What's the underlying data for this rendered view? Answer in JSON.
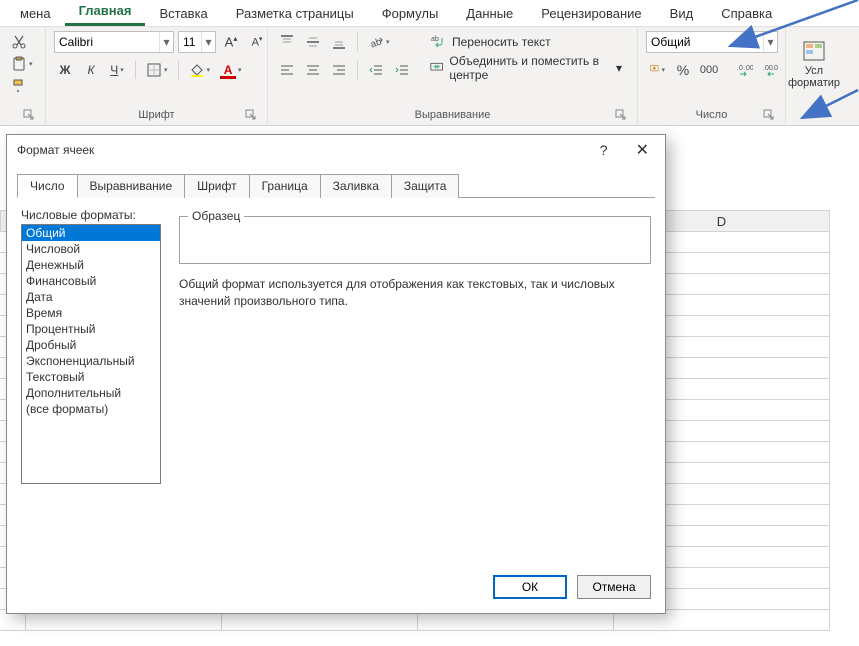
{
  "tabs": {
    "items": [
      "мена",
      "Главная",
      "Вставка",
      "Разметка страницы",
      "Формулы",
      "Данные",
      "Рецензирование",
      "Вид",
      "Справка"
    ],
    "active_index": 1
  },
  "clipboard": {
    "label": ""
  },
  "font": {
    "name": "Calibri",
    "size": "11",
    "group_label": "Шрифт",
    "bold": "Ж",
    "italic": "К",
    "underline": "Ч"
  },
  "alignment": {
    "group_label": "Выравнивание",
    "wrap_label": "Переносить текст",
    "merge_label": "Объединить и поместить в центре"
  },
  "number": {
    "group_label": "Число",
    "format_value": "Общий"
  },
  "cond": {
    "label": "Усл форматир"
  },
  "sheet": {
    "col_D": "D"
  },
  "dialog": {
    "title": "Формат ячеек",
    "help": "?",
    "close": "✕",
    "tabs": [
      "Число",
      "Выравнивание",
      "Шрифт",
      "Граница",
      "Заливка",
      "Защита"
    ],
    "active_tab": 0,
    "list_label": "Числовые форматы:",
    "formats": [
      "Общий",
      "Числовой",
      "Денежный",
      "Финансовый",
      "Дата",
      "Время",
      "Процентный",
      "Дробный",
      "Экспоненциальный",
      "Текстовый",
      "Дополнительный",
      "(все форматы)"
    ],
    "selected_format": 0,
    "sample_label": "Образец",
    "description": "Общий формат используется для отображения как текстовых, так и числовых значений произвольного типа.",
    "ok": "ОК",
    "cancel": "Отмена"
  }
}
